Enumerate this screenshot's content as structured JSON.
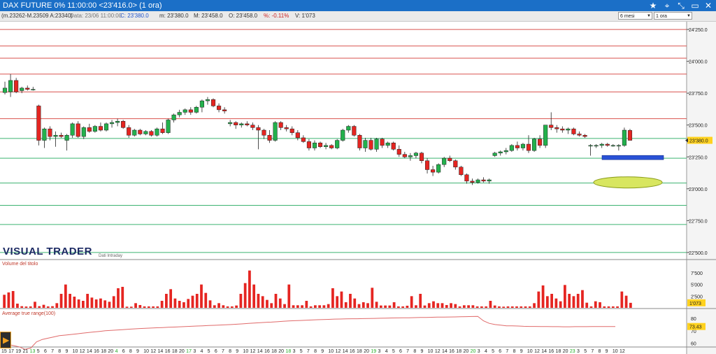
{
  "window": {
    "title": "DAX FUTURE 0%  11:00:00  <23'416.0>  (1 ora)",
    "controls": {
      "star": "★",
      "pin": "⌖",
      "resize": "⤡",
      "minimize": "▭",
      "close": "✕"
    }
  },
  "infobar": {
    "params": "(m.23262-M.23509 A:23340)",
    "date": "Data: 23/06 11:00:00",
    "close": "C: 23'380.0",
    "min": "m: 23'380.0",
    "max": "M: 23'458.0",
    "open": "O: 23'458.0",
    "pct": "%: -0.11%",
    "vol": "V: 1'073",
    "period_select": "6 mesi",
    "tf_select": "1 ora"
  },
  "colors": {
    "up": "#22b14c",
    "down": "#e52521",
    "volume": "#e52521",
    "atr": "#e06a6a",
    "hline_red": "#d9534f",
    "hline_green": "#3cb371",
    "accent": "#1b6fc7"
  },
  "logo": {
    "text": "VISUAL TRADER",
    "sub": "Dati Intraday"
  },
  "panels": {
    "volume_label": "Volume del titolo",
    "atr_label": "Average true range(100)"
  },
  "price_axis": {
    "ticks": [
      "24'250.0",
      "24'000.0",
      "23'750.0",
      "23'500.0",
      "23'250.0",
      "23'000.0",
      "22'750.0",
      "22'500.0"
    ],
    "current": "23'380.0"
  },
  "volume_axis": {
    "ticks": [
      "7'500",
      "5'000",
      "2'500"
    ],
    "current": "1'073"
  },
  "atr_axis": {
    "ticks": [
      "80",
      "70",
      "60"
    ],
    "current": "73.43"
  },
  "chart_data": {
    "type": "candlestick",
    "price_range": [
      22450,
      24300
    ],
    "horizontal_levels_red": [
      24250,
      24120,
      24025,
      23900,
      23760,
      23550
    ],
    "horizontal_levels_green": [
      23395,
      23240,
      23045,
      22870,
      22720,
      22500
    ],
    "candles": [
      {
        "o": 23755,
        "h": 23840,
        "l": 23740,
        "c": 23790
      },
      {
        "o": 23760,
        "h": 23900,
        "l": 23720,
        "c": 23850
      },
      {
        "o": 23850,
        "h": 23870,
        "l": 23750,
        "c": 23760
      },
      {
        "o": 23770,
        "h": 23800,
        "l": 23750,
        "c": 23790
      },
      {
        "o": 23790,
        "h": 23810,
        "l": 23770,
        "c": 23780
      },
      {
        "o": 23780,
        "h": 23800,
        "l": 23770,
        "c": 23780
      },
      {
        "o": 23650,
        "h": 23660,
        "l": 23340,
        "c": 23380
      },
      {
        "o": 23380,
        "h": 23480,
        "l": 23320,
        "c": 23470
      },
      {
        "o": 23470,
        "h": 23490,
        "l": 23380,
        "c": 23410
      },
      {
        "o": 23410,
        "h": 23450,
        "l": 23330,
        "c": 23420
      },
      {
        "o": 23420,
        "h": 23440,
        "l": 23400,
        "c": 23410
      },
      {
        "o": 23380,
        "h": 23430,
        "l": 23300,
        "c": 23420
      },
      {
        "o": 23420,
        "h": 23520,
        "l": 23400,
        "c": 23510
      },
      {
        "o": 23510,
        "h": 23530,
        "l": 23400,
        "c": 23410
      },
      {
        "o": 23410,
        "h": 23490,
        "l": 23390,
        "c": 23480
      },
      {
        "o": 23480,
        "h": 23510,
        "l": 23440,
        "c": 23450
      },
      {
        "o": 23450,
        "h": 23500,
        "l": 23440,
        "c": 23490
      },
      {
        "o": 23490,
        "h": 23520,
        "l": 23450,
        "c": 23460
      },
      {
        "o": 23460,
        "h": 23520,
        "l": 23450,
        "c": 23510
      },
      {
        "o": 23510,
        "h": 23540,
        "l": 23480,
        "c": 23520
      },
      {
        "o": 23520,
        "h": 23550,
        "l": 23490,
        "c": 23530
      },
      {
        "o": 23530,
        "h": 23540,
        "l": 23470,
        "c": 23480
      },
      {
        "o": 23480,
        "h": 23500,
        "l": 23400,
        "c": 23420
      },
      {
        "o": 23420,
        "h": 23470,
        "l": 23410,
        "c": 23460
      },
      {
        "o": 23460,
        "h": 23470,
        "l": 23420,
        "c": 23430
      },
      {
        "o": 23430,
        "h": 23460,
        "l": 23420,
        "c": 23450
      },
      {
        "o": 23450,
        "h": 23460,
        "l": 23410,
        "c": 23420
      },
      {
        "o": 23420,
        "h": 23480,
        "l": 23410,
        "c": 23470
      },
      {
        "o": 23470,
        "h": 23520,
        "l": 23430,
        "c": 23440
      },
      {
        "o": 23440,
        "h": 23550,
        "l": 23430,
        "c": 23540
      },
      {
        "o": 23540,
        "h": 23590,
        "l": 23520,
        "c": 23580
      },
      {
        "o": 23580,
        "h": 23620,
        "l": 23560,
        "c": 23600
      },
      {
        "o": 23600,
        "h": 23630,
        "l": 23580,
        "c": 23620
      },
      {
        "o": 23620,
        "h": 23640,
        "l": 23580,
        "c": 23600
      },
      {
        "o": 23600,
        "h": 23650,
        "l": 23590,
        "c": 23640
      },
      {
        "o": 23640,
        "h": 23700,
        "l": 23600,
        "c": 23690
      },
      {
        "o": 23690,
        "h": 23720,
        "l": 23660,
        "c": 23700
      },
      {
        "o": 23700,
        "h": 23710,
        "l": 23640,
        "c": 23650
      },
      {
        "o": 23650,
        "h": 23670,
        "l": 23600,
        "c": 23620
      },
      {
        "o": 23620,
        "h": 23640,
        "l": 23590,
        "c": 23610
      },
      {
        "o": 23510,
        "h": 23540,
        "l": 23490,
        "c": 23520
      },
      {
        "o": 23520,
        "h": 23530,
        "l": 23470,
        "c": 23500
      },
      {
        "o": 23500,
        "h": 23520,
        "l": 23480,
        "c": 23510
      },
      {
        "o": 23510,
        "h": 23530,
        "l": 23490,
        "c": 23500
      },
      {
        "o": 23500,
        "h": 23520,
        "l": 23460,
        "c": 23480
      },
      {
        "o": 23480,
        "h": 23500,
        "l": 23310,
        "c": 23460
      },
      {
        "o": 23460,
        "h": 23470,
        "l": 23390,
        "c": 23420
      },
      {
        "o": 23420,
        "h": 23460,
        "l": 23360,
        "c": 23380
      },
      {
        "o": 23380,
        "h": 23530,
        "l": 23370,
        "c": 23520
      },
      {
        "o": 23520,
        "h": 23530,
        "l": 23460,
        "c": 23480
      },
      {
        "o": 23480,
        "h": 23500,
        "l": 23450,
        "c": 23470
      },
      {
        "o": 23470,
        "h": 23490,
        "l": 23420,
        "c": 23440
      },
      {
        "o": 23440,
        "h": 23460,
        "l": 23380,
        "c": 23400
      },
      {
        "o": 23400,
        "h": 23420,
        "l": 23360,
        "c": 23370
      },
      {
        "o": 23370,
        "h": 23390,
        "l": 23300,
        "c": 23320
      },
      {
        "o": 23320,
        "h": 23380,
        "l": 23300,
        "c": 23360
      },
      {
        "o": 23360,
        "h": 23370,
        "l": 23320,
        "c": 23330
      },
      {
        "o": 23330,
        "h": 23360,
        "l": 23310,
        "c": 23340
      },
      {
        "o": 23340,
        "h": 23350,
        "l": 23310,
        "c": 23320
      },
      {
        "o": 23320,
        "h": 23390,
        "l": 23310,
        "c": 23380
      },
      {
        "o": 23380,
        "h": 23470,
        "l": 23370,
        "c": 23460
      },
      {
        "o": 23460,
        "h": 23500,
        "l": 23440,
        "c": 23490
      },
      {
        "o": 23490,
        "h": 23500,
        "l": 23410,
        "c": 23420
      },
      {
        "o": 23420,
        "h": 23430,
        "l": 23300,
        "c": 23320
      },
      {
        "o": 23320,
        "h": 23400,
        "l": 23290,
        "c": 23380
      },
      {
        "o": 23380,
        "h": 23400,
        "l": 23300,
        "c": 23310
      },
      {
        "o": 23310,
        "h": 23400,
        "l": 23290,
        "c": 23390
      },
      {
        "o": 23390,
        "h": 23400,
        "l": 23320,
        "c": 23340
      },
      {
        "o": 23340,
        "h": 23370,
        "l": 23320,
        "c": 23360
      },
      {
        "o": 23360,
        "h": 23370,
        "l": 23300,
        "c": 23310
      },
      {
        "o": 23310,
        "h": 23340,
        "l": 23250,
        "c": 23270
      },
      {
        "o": 23270,
        "h": 23290,
        "l": 23240,
        "c": 23250
      },
      {
        "o": 23250,
        "h": 23280,
        "l": 23220,
        "c": 23260
      },
      {
        "o": 23260,
        "h": 23290,
        "l": 23240,
        "c": 23280
      },
      {
        "o": 23280,
        "h": 23290,
        "l": 23200,
        "c": 23220
      },
      {
        "o": 23220,
        "h": 23240,
        "l": 23120,
        "c": 23150
      },
      {
        "o": 23150,
        "h": 23180,
        "l": 23100,
        "c": 23130
      },
      {
        "o": 23130,
        "h": 23200,
        "l": 23120,
        "c": 23190
      },
      {
        "o": 23190,
        "h": 23250,
        "l": 23170,
        "c": 23240
      },
      {
        "o": 23240,
        "h": 23260,
        "l": 23210,
        "c": 23220
      },
      {
        "o": 23220,
        "h": 23230,
        "l": 23150,
        "c": 23170
      },
      {
        "o": 23170,
        "h": 23180,
        "l": 23100,
        "c": 23110
      },
      {
        "o": 23110,
        "h": 23120,
        "l": 23040,
        "c": 23060
      },
      {
        "o": 23060,
        "h": 23080,
        "l": 23030,
        "c": 23050
      },
      {
        "o": 23050,
        "h": 23080,
        "l": 23040,
        "c": 23070
      },
      {
        "o": 23070,
        "h": 23090,
        "l": 23050,
        "c": 23060
      },
      {
        "o": 23060,
        "h": 23080,
        "l": 23040,
        "c": 23070
      },
      {
        "o": 23260,
        "h": 23290,
        "l": 23250,
        "c": 23280
      },
      {
        "o": 23280,
        "h": 23300,
        "l": 23260,
        "c": 23290
      },
      {
        "o": 23290,
        "h": 23320,
        "l": 23270,
        "c": 23300
      },
      {
        "o": 23300,
        "h": 23350,
        "l": 23290,
        "c": 23340
      },
      {
        "o": 23340,
        "h": 23370,
        "l": 23300,
        "c": 23320
      },
      {
        "o": 23320,
        "h": 23360,
        "l": 23300,
        "c": 23350
      },
      {
        "o": 23350,
        "h": 23420,
        "l": 23280,
        "c": 23300
      },
      {
        "o": 23300,
        "h": 23400,
        "l": 23290,
        "c": 23390
      },
      {
        "o": 23390,
        "h": 23420,
        "l": 23320,
        "c": 23340
      },
      {
        "o": 23340,
        "h": 23500,
        "l": 23320,
        "c": 23500
      },
      {
        "o": 23500,
        "h": 23600,
        "l": 23460,
        "c": 23480
      },
      {
        "o": 23480,
        "h": 23500,
        "l": 23440,
        "c": 23470
      },
      {
        "o": 23470,
        "h": 23490,
        "l": 23440,
        "c": 23460
      },
      {
        "o": 23460,
        "h": 23480,
        "l": 23430,
        "c": 23470
      },
      {
        "o": 23470,
        "h": 23480,
        "l": 23420,
        "c": 23430
      },
      {
        "o": 23430,
        "h": 23450,
        "l": 23410,
        "c": 23420
      },
      {
        "o": 23420,
        "h": 23430,
        "l": 23400,
        "c": 23410
      },
      {
        "o": 23340,
        "h": 23350,
        "l": 23260,
        "c": 23340
      },
      {
        "o": 23340,
        "h": 23350,
        "l": 23320,
        "c": 23340
      },
      {
        "o": 23340,
        "h": 23360,
        "l": 23320,
        "c": 23350
      },
      {
        "o": 23350,
        "h": 23360,
        "l": 23330,
        "c": 23340
      },
      {
        "o": 23340,
        "h": 23350,
        "l": 23330,
        "c": 23340
      },
      {
        "o": 23340,
        "h": 23350,
        "l": 23300,
        "c": 23340
      },
      {
        "o": 23340,
        "h": 23480,
        "l": 23330,
        "c": 23460
      },
      {
        "o": 23458,
        "h": 23470,
        "l": 23380,
        "c": 23380
      }
    ],
    "volume": [
      2800,
      3300,
      3600,
      900,
      350,
      280,
      300,
      1300,
      350,
      650,
      300,
      350,
      1000,
      3000,
      5000,
      3000,
      2400,
      1800,
      1500,
      3000,
      2200,
      1800,
      2000,
      1600,
      1300,
      2500,
      4200,
      4500,
      250,
      250,
      1000,
      600,
      300,
      300,
      300,
      300,
      1500,
      3000,
      4000,
      2000,
      1500,
      1200,
      1900,
      2600,
      3000,
      5000,
      3200,
      1600,
      550,
      1000,
      550,
      300,
      300,
      500,
      3000,
      5300,
      8000,
      5000,
      3000,
      2500,
      1700,
      1000,
      3000,
      2000,
      800,
      5000,
      550,
      550,
      550,
      1500,
      300,
      550,
      550,
      550,
      800,
      4200,
      2500,
      3500,
      1200,
      3000,
      2000,
      800,
      1200,
      1000,
      4300,
      1300,
      500,
      500,
      500,
      1200,
      300,
      300,
      450,
      2500,
      550,
      3000,
      500,
      1000,
      1400,
      1000,
      1000,
      600,
      1000,
      800,
      300,
      550,
      550,
      550,
      300,
      300,
      300,
      1500,
      500,
      300,
      250,
      300,
      300,
      300,
      300,
      300,
      300,
      1000,
      3500,
      4800,
      2500,
      3000,
      2000,
      1400,
      4900,
      3000,
      2500,
      3000,
      3800,
      1100,
      300,
      1400,
      1200,
      300,
      300,
      300,
      300,
      3500,
      2600,
      1073
    ],
    "atr_range": [
      58,
      84
    ],
    "atr": [
      60,
      59,
      58,
      57,
      55,
      56,
      61,
      63,
      64,
      65,
      66,
      66.5,
      67,
      67.5,
      68,
      68.5,
      69,
      69.5,
      70,
      70.3,
      70.6,
      70.9,
      71.2,
      71.5,
      71.8,
      72,
      72.2,
      72.4,
      72.6,
      72.8,
      73,
      73.2,
      73.4,
      73.6,
      73.8,
      74,
      74.2,
      74.4,
      74.6,
      74.8,
      75,
      75.3,
      75.6,
      75.9,
      76.2,
      76.5,
      76.8,
      77,
      77.3,
      77.6,
      77.9,
      78.1,
      78.3,
      78.5,
      78.7,
      78.9,
      79,
      79.2,
      79.4,
      79.5,
      79.6,
      79.7,
      79.7,
      79.8,
      79.9,
      80,
      80.1,
      80.2,
      80.3,
      80.4,
      80.5,
      80.5,
      80.6,
      80.7,
      80.8,
      80.9,
      81,
      81,
      81.1,
      81.2,
      81.3,
      81.4,
      81.5,
      81.6,
      78,
      76,
      75,
      74.5,
      74,
      74,
      73.8,
      73.6,
      73.5,
      73.5,
      73.4,
      73.4,
      73.3,
      73.3,
      73.2,
      73.2,
      73.3,
      73.3,
      73.3,
      73.4,
      73.4,
      73.4,
      73.43,
      73.43
    ],
    "x_labels": [
      "15",
      "17",
      "19",
      "21",
      "13",
      "5",
      "6",
      "7",
      "8",
      "9",
      "10",
      "12",
      "14",
      "16",
      "18",
      "20",
      "4",
      "6",
      "8",
      "9",
      "10",
      "12",
      "14",
      "16",
      "18",
      "20",
      "17",
      "3",
      "4",
      "5",
      "6",
      "7",
      "8",
      "9",
      "10",
      "12",
      "14",
      "16",
      "18",
      "20",
      "18",
      "3",
      "5",
      "7",
      "8",
      "9",
      "10",
      "12",
      "14",
      "16",
      "18",
      "20",
      "19",
      "3",
      "4",
      "5",
      "6",
      "7",
      "8",
      "9",
      "10",
      "12",
      "14",
      "16",
      "18",
      "20",
      "20",
      "3",
      "4",
      "5",
      "6",
      "7",
      "8",
      "9",
      "10",
      "12",
      "14",
      "16",
      "18",
      "20",
      "23",
      "3",
      "5",
      "7",
      "8",
      "9",
      "10",
      "12"
    ],
    "annotations": {
      "blue_bar_level": 23245,
      "yellow_ellipse_level": 23050
    }
  }
}
